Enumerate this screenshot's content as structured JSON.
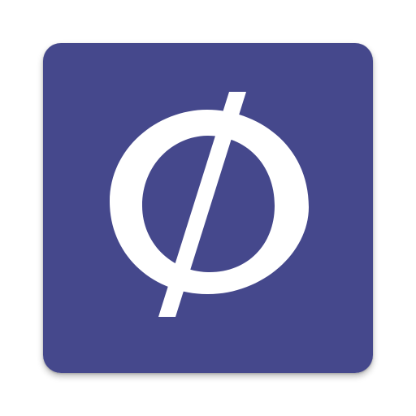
{
  "icon": {
    "name": "phi-icon",
    "symbol": "ϕ",
    "background_color": "#45488c",
    "glyph_color": "#ffffff"
  }
}
